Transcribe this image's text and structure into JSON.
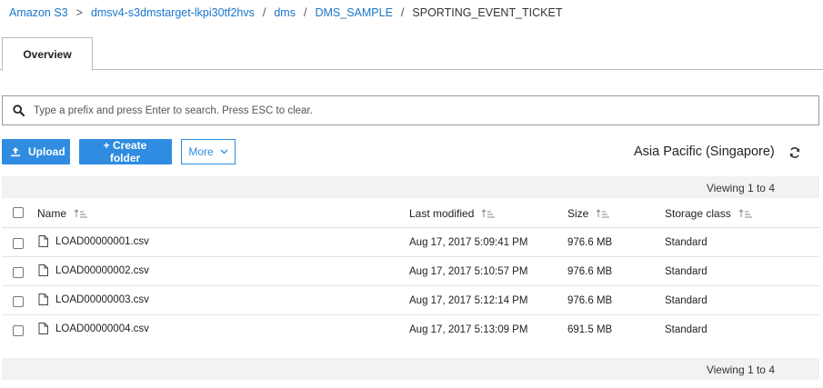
{
  "breadcrumb": {
    "items": [
      "Amazon S3",
      "dmsv4-s3dmstarget-lkpi30tf2hvs",
      "dms",
      "DMS_SAMPLE"
    ],
    "separators": [
      ">",
      "/",
      "/",
      "/"
    ],
    "current": "SPORTING_EVENT_TICKET"
  },
  "tabs": [
    {
      "label": "Overview"
    }
  ],
  "search": {
    "placeholder": "Type a prefix and press Enter to search. Press ESC to clear.",
    "value": "",
    "icon": "search-icon"
  },
  "toolbar": {
    "upload_label": "Upload",
    "create_folder_label": "+ Create folder",
    "more_label": "More",
    "region": "Asia Pacific (Singapore)",
    "refresh_icon": "refresh-icon"
  },
  "viewing": {
    "top": "Viewing 1 to 4",
    "bottom": "Viewing 1 to 4"
  },
  "table": {
    "columns": [
      "Name",
      "Last modified",
      "Size",
      "Storage class"
    ],
    "rows": [
      {
        "name": "LOAD00000001.csv",
        "modified": "Aug 17, 2017 5:09:41 PM",
        "size": "976.6 MB",
        "storage_class": "Standard"
      },
      {
        "name": "LOAD00000002.csv",
        "modified": "Aug 17, 2017 5:10:57 PM",
        "size": "976.6 MB",
        "storage_class": "Standard"
      },
      {
        "name": "LOAD00000003.csv",
        "modified": "Aug 17, 2017 5:12:14 PM",
        "size": "976.6 MB",
        "storage_class": "Standard"
      },
      {
        "name": "LOAD00000004.csv",
        "modified": "Aug 17, 2017 5:13:09 PM",
        "size": "691.5 MB",
        "storage_class": "Standard"
      }
    ]
  },
  "colors": {
    "link": "#1a76c9",
    "primary_button": "#2f8ce0",
    "bar_background": "#f2f2f2"
  }
}
